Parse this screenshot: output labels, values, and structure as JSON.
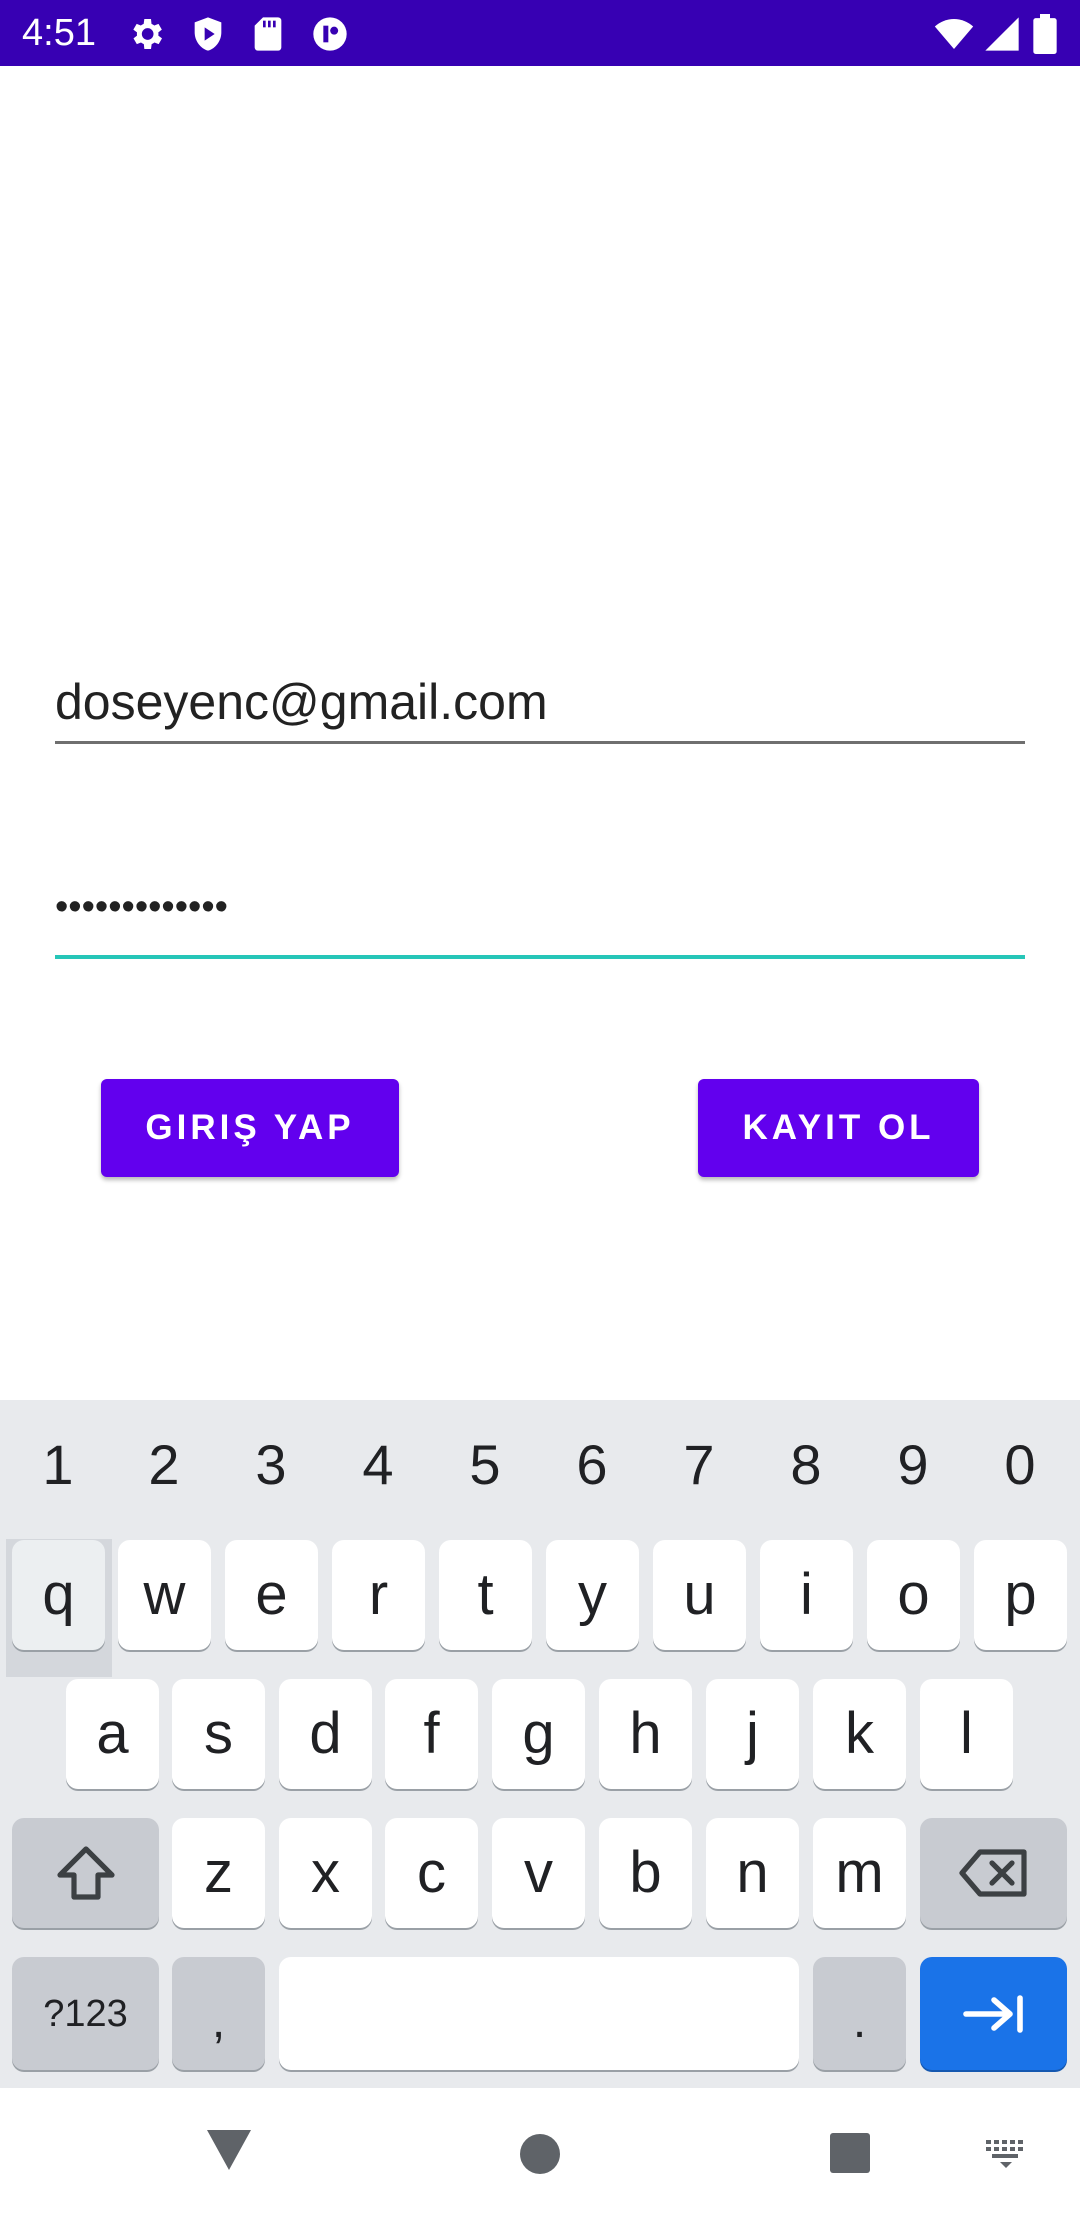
{
  "status_bar": {
    "time": "4:51",
    "left_icons": [
      "gear-icon",
      "play-shield-icon",
      "sd-card-icon",
      "notification-icon"
    ],
    "right_icons": [
      "wifi-icon",
      "signal-icon",
      "battery-icon"
    ],
    "background": "#3700b3"
  },
  "form": {
    "email_value": "doseyenc@gmail.com",
    "password_value": "•••••••••••••",
    "login_label": "GIRIŞ YAP",
    "register_label": "KAYIT OL",
    "button_color": "#6200ee",
    "focus_color": "#26c6b8"
  },
  "keyboard": {
    "numbers": [
      "1",
      "2",
      "3",
      "4",
      "5",
      "6",
      "7",
      "8",
      "9",
      "0"
    ],
    "row1": [
      "q",
      "w",
      "e",
      "r",
      "t",
      "y",
      "u",
      "i",
      "o",
      "p"
    ],
    "row2": [
      "a",
      "s",
      "d",
      "f",
      "g",
      "h",
      "j",
      "k",
      "l"
    ],
    "row3": [
      "z",
      "x",
      "c",
      "v",
      "b",
      "n",
      "m"
    ],
    "symbols_label": "?123",
    "comma_label": ",",
    "period_label": ".",
    "shift_icon": "shift-icon",
    "backspace_icon": "backspace-icon",
    "enter_icon": "next-tab-icon",
    "enter_color": "#1a73e8"
  },
  "nav_bar": {
    "icons": [
      "back-icon",
      "home-icon",
      "recents-icon",
      "keyboard-switch-icon"
    ]
  }
}
